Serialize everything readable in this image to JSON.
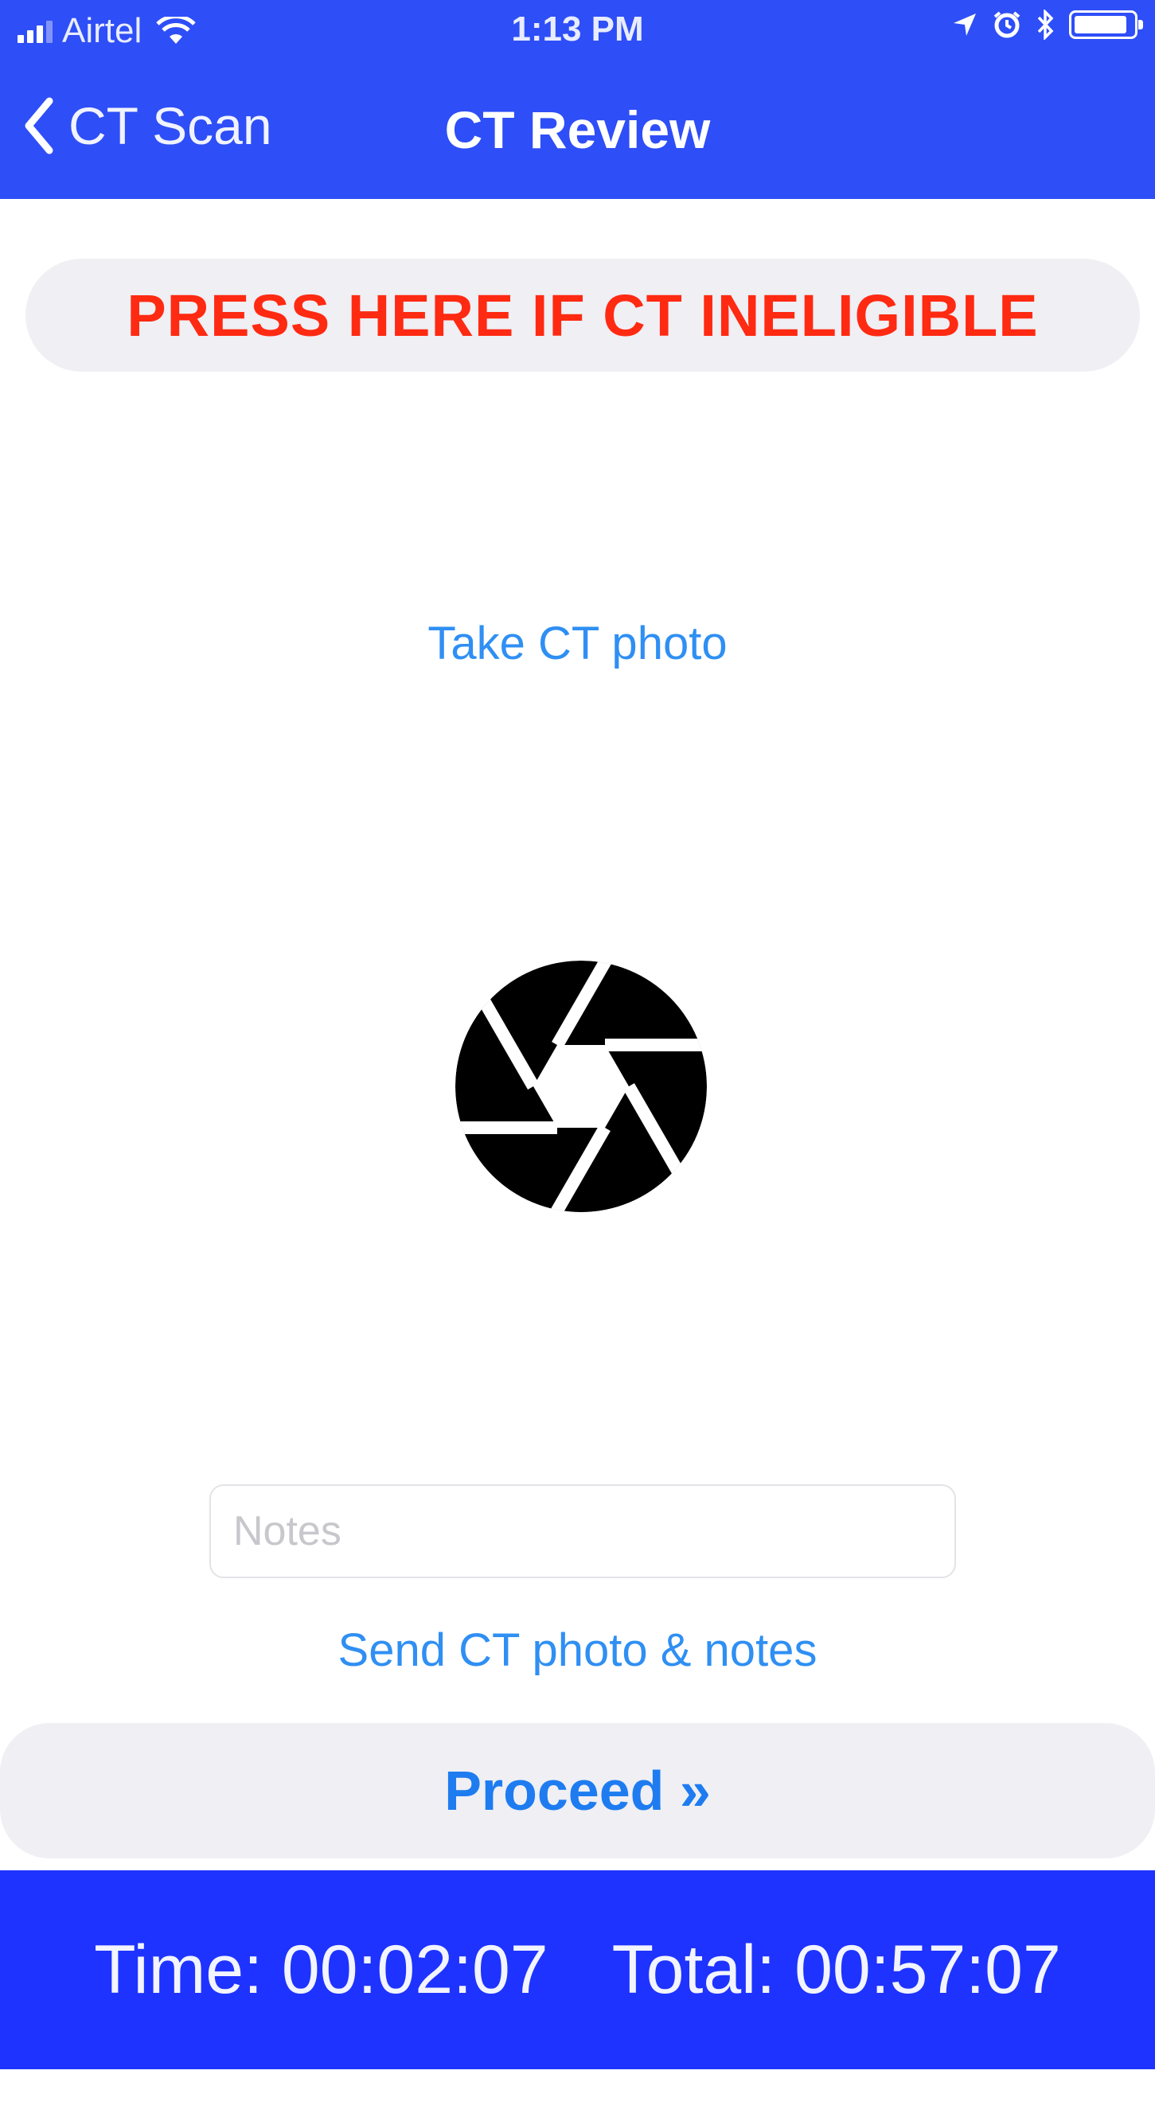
{
  "status_bar": {
    "carrier": "Airtel",
    "time": "1:13 PM",
    "battery_level": 0.9,
    "icons": [
      "signal-icon",
      "wifi-icon",
      "location-icon",
      "alarm-icon",
      "bluetooth-icon",
      "battery-icon"
    ]
  },
  "nav": {
    "back_label": "CT Scan",
    "title": "CT Review"
  },
  "ineligible_button": {
    "label": "PRESS HERE IF CT INELIGIBLE"
  },
  "take_photo": {
    "label": "Take CT photo"
  },
  "camera": {
    "icon": "camera-shutter-icon"
  },
  "notes": {
    "placeholder": "Notes",
    "value": ""
  },
  "send": {
    "label": "Send CT photo & notes"
  },
  "proceed": {
    "label": "Proceed »"
  },
  "timer": {
    "time": "Time: 00:02:07",
    "total": "Total: 00:57:07"
  },
  "colors": {
    "nav_bar": "#2e4ef7",
    "timer_bar": "#1e33ff",
    "alert_text": "#ff2a12",
    "link": "#2f8ff3",
    "pill_bg": "#efeff4"
  }
}
